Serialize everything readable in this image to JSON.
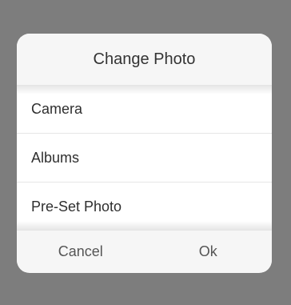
{
  "dialog": {
    "title": "Change Photo",
    "options": [
      {
        "label": "Camera"
      },
      {
        "label": "Albums"
      },
      {
        "label": "Pre-Set Photo"
      }
    ],
    "cancel_label": "Cancel",
    "ok_label": "Ok"
  },
  "colors": {
    "overlay": "#7d7d7d",
    "dialog_background": "#f6f6f6",
    "option_background": "#ffffff",
    "text": "#333333"
  }
}
